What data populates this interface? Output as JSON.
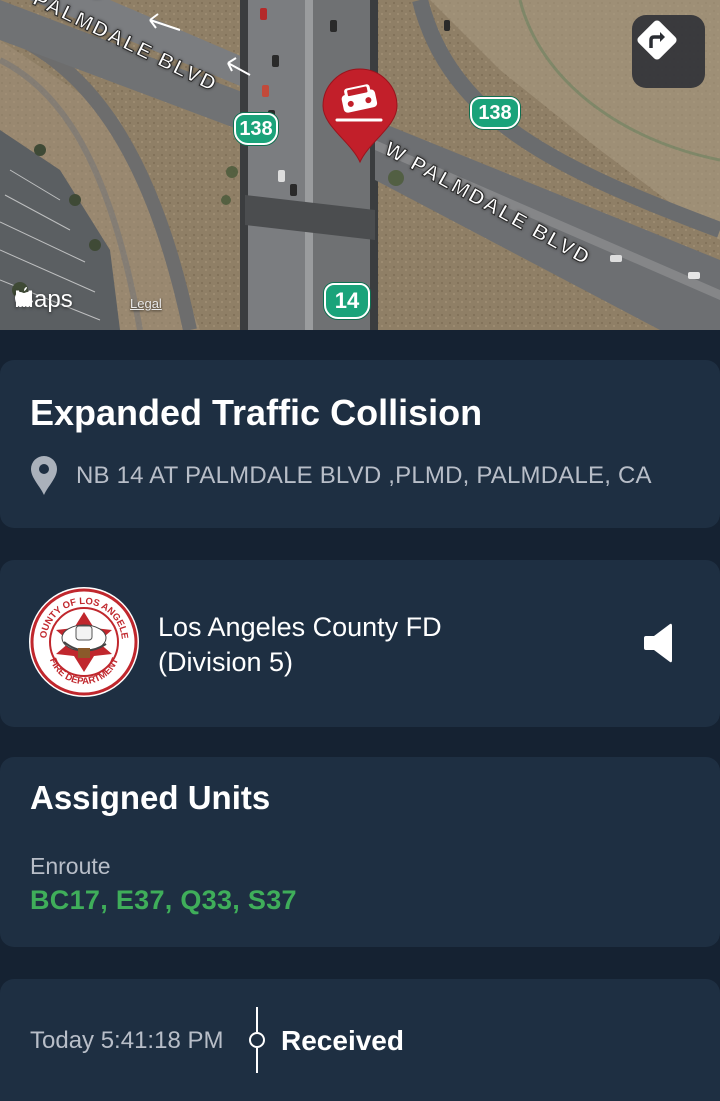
{
  "map": {
    "attribution_logo": "Maps",
    "attribution_legal": "Legal",
    "road_labels": [
      "PALMDALE BLVD",
      "W PALMDALE BLVD"
    ],
    "top_cut_label": "D",
    "shields": [
      "138",
      "138",
      "14"
    ],
    "pin_icon": "car-crash-icon",
    "directions_icon": "directions-icon"
  },
  "incident": {
    "title": "Expanded Traffic Collision",
    "location": "NB 14 AT PALMDALE BLVD ,PLMD, PALMDALE, CA"
  },
  "agency": {
    "name_line1": "Los Angeles County FD",
    "name_line2": "(Division 5)",
    "seal_top_text": "COUNTY OF LOS ANGELES",
    "seal_bottom_text": "FIRE DEPARTMENT",
    "audio_icon": "speaker-icon"
  },
  "units": {
    "heading": "Assigned Units",
    "status": "Enroute",
    "list": "BC17, E37, Q33, S37"
  },
  "timeline": {
    "time": "Today 5:41:18 PM",
    "event": "Received"
  },
  "colors": {
    "background": "#152232",
    "card": "#1e2f42",
    "units_green": "#3fae5a",
    "pin_red": "#c21f2a",
    "shield_green": "#1aa37a"
  }
}
